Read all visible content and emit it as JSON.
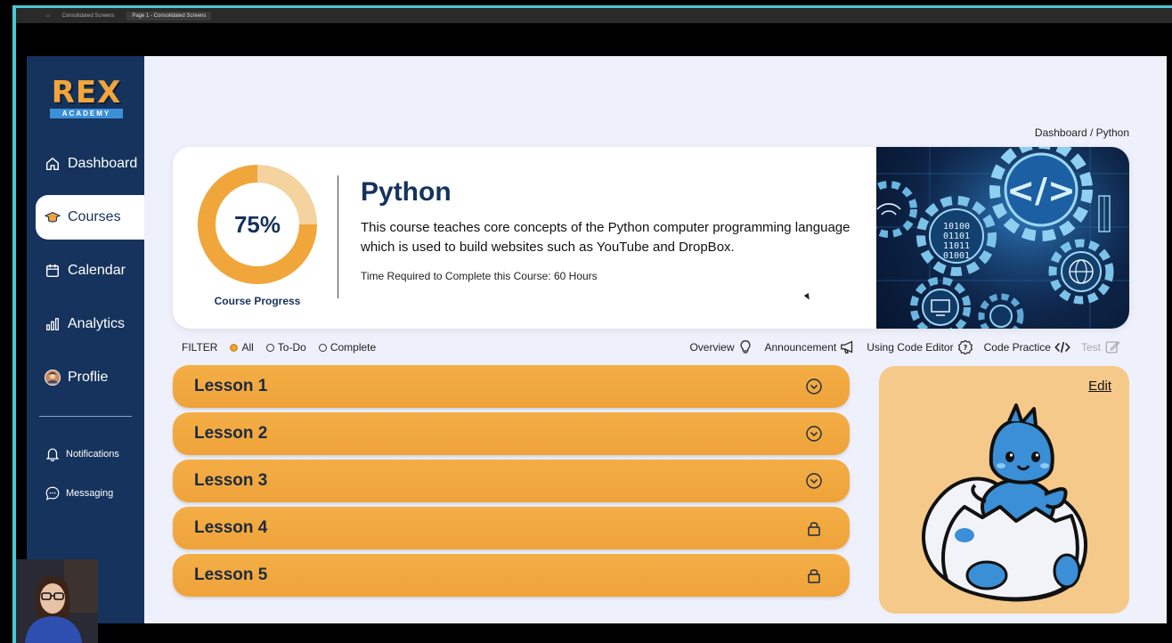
{
  "topbar": {
    "tab1": "Consolidated Screens",
    "tab2": "Page 1 - Consolidated Screens"
  },
  "logo": {
    "name": "REX",
    "sub": "ACADEMY"
  },
  "sidebar": {
    "items": [
      {
        "label": "Dashboard",
        "icon": "home-icon"
      },
      {
        "label": "Courses",
        "icon": "graduation-cap-icon",
        "active": true
      },
      {
        "label": "Calendar",
        "icon": "calendar-icon"
      },
      {
        "label": "Analytics",
        "icon": "bar-chart-icon"
      },
      {
        "label": "Proflie",
        "icon": "avatar"
      }
    ],
    "secondary": [
      {
        "label": "Notifications",
        "icon": "bell-icon"
      },
      {
        "label": "Messaging",
        "icon": "chat-bubble-icon"
      }
    ]
  },
  "breadcrumb": "Dashboard / Python",
  "course": {
    "progress_percent": 75,
    "progress_text": "75%",
    "progress_label": "Course Progress",
    "title": "Python",
    "description": "This course teaches core concepts of the Python computer programming language which is used to build websites such as YouTube and DropBox.",
    "time_required": "Time Required to Complete this Course: 60 Hours"
  },
  "filter": {
    "label": "FILTER",
    "options": [
      "All",
      "To-Do",
      "Complete"
    ],
    "selected": "All"
  },
  "tools": [
    {
      "label": "Overview",
      "icon": "lightbulb-icon"
    },
    {
      "label": "Announcement",
      "icon": "megaphone-icon"
    },
    {
      "label": "Using Code Editor",
      "icon": "question-icon"
    },
    {
      "label": "Code Practice",
      "icon": "code-icon"
    },
    {
      "label": "Test",
      "icon": "edit-icon",
      "disabled": true
    }
  ],
  "lessons": [
    {
      "label": "Lesson 1",
      "status": "chevron-down-icon"
    },
    {
      "label": "Lesson 2",
      "status": "chevron-down-icon"
    },
    {
      "label": "Lesson 3",
      "status": "chevron-down-icon"
    },
    {
      "label": "Lesson 4",
      "status": "lock-icon"
    },
    {
      "label": "Lesson 5",
      "status": "lock-icon"
    }
  ],
  "mascot_card": {
    "edit_label": "Edit"
  },
  "colors": {
    "sidebar": "#15335c",
    "accent_orange": "#f0a63a",
    "donut_light": "#f4d39e",
    "mascot_bg": "#f4c98a",
    "mascot_blue": "#3a8fd6"
  }
}
